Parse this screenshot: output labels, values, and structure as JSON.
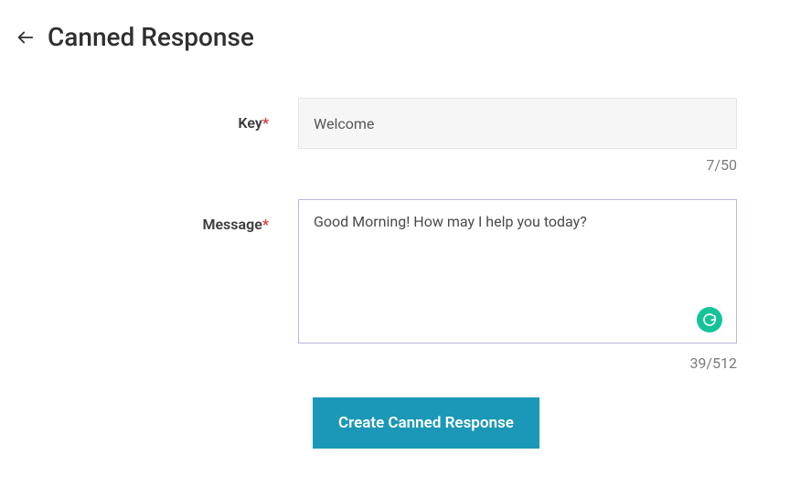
{
  "header": {
    "title": "Canned Response"
  },
  "form": {
    "key": {
      "label": "Key",
      "required_mark": "*",
      "value": "Welcome",
      "counter": "7/50"
    },
    "message": {
      "label": "Message",
      "required_mark": "*",
      "value": "Good Morning! How may I help you today?",
      "counter": "39/512"
    },
    "submit_label": "Create Canned Response"
  }
}
